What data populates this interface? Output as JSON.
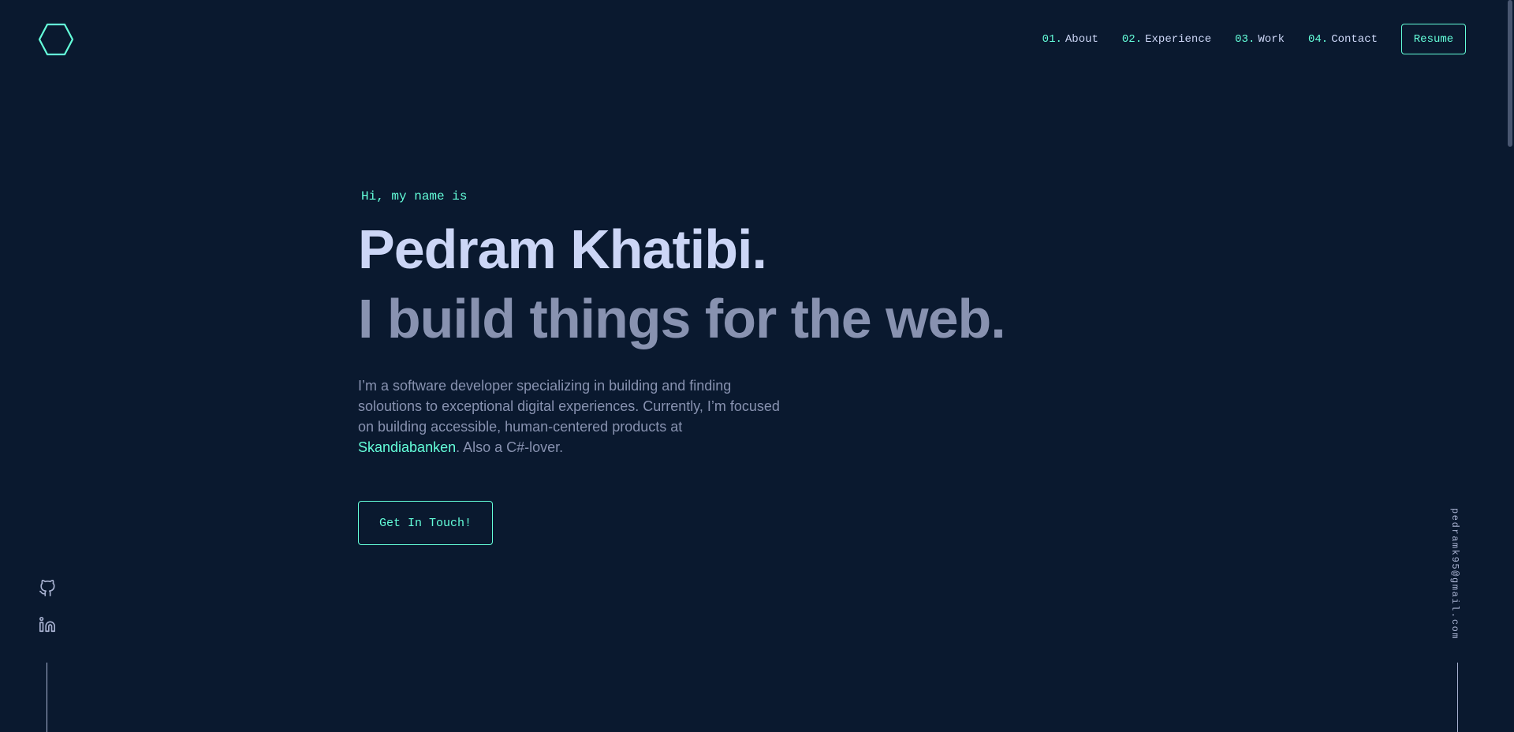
{
  "colors": {
    "background": "#0a192f",
    "accent": "#64ffda",
    "heading": "#ccd6f6",
    "text": "#8892b0"
  },
  "header": {
    "logo_icon": "hexagon-icon",
    "nav": [
      {
        "num": "01.",
        "label": "About"
      },
      {
        "num": "02.",
        "label": "Experience"
      },
      {
        "num": "03.",
        "label": "Work"
      },
      {
        "num": "04.",
        "label": "Contact"
      }
    ],
    "resume_label": "Resume"
  },
  "hero": {
    "greeting": "Hi, my name is",
    "name": "Pedram Khatibi.",
    "tagline": "I build things for the web.",
    "intro_before": "I’m a software developer specializing in building and finding soloutions to exceptional digital experiences. Currently, I’m focused on building accessible, human-centered products at ",
    "intro_link": "Skandiabanken",
    "intro_after": ". Also a C#-lover.",
    "cta_label": "Get In Touch!"
  },
  "social": {
    "links": [
      {
        "icon": "github-icon"
      },
      {
        "icon": "linkedin-icon"
      }
    ]
  },
  "email": "pedramk95@gmail.com"
}
